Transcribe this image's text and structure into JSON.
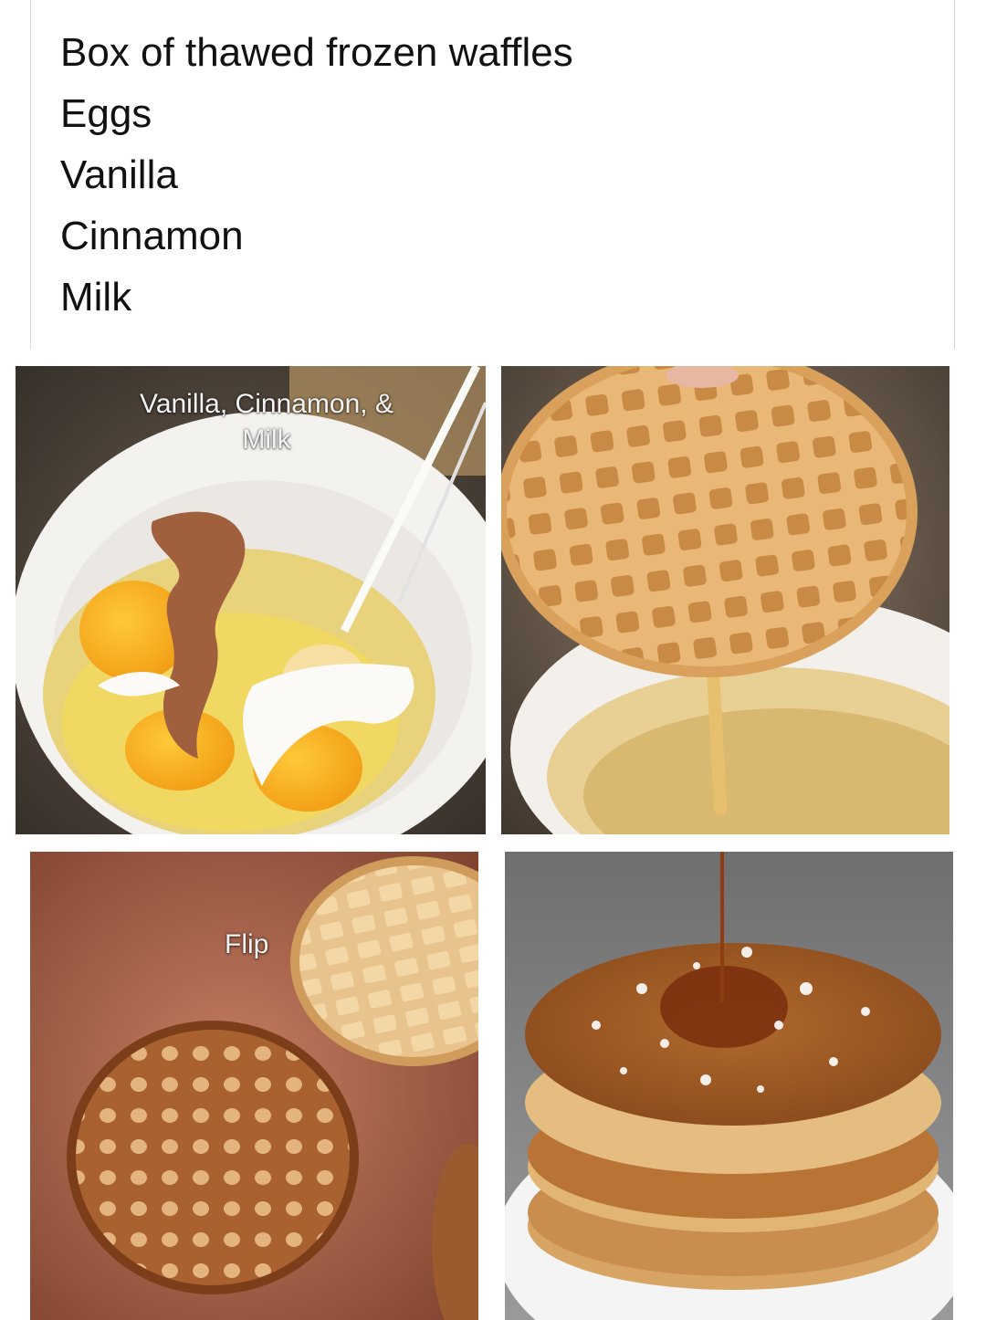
{
  "ingredients": [
    "Box of thawed frozen waffles",
    "Eggs",
    "Vanilla",
    "Cinnamon",
    "Milk"
  ],
  "steps": [
    {
      "caption_line1": "Vanilla, Cinnamon, &",
      "caption_line2": "Milk"
    },
    {
      "caption": ""
    },
    {
      "caption": "Flip"
    },
    {
      "caption": ""
    }
  ]
}
